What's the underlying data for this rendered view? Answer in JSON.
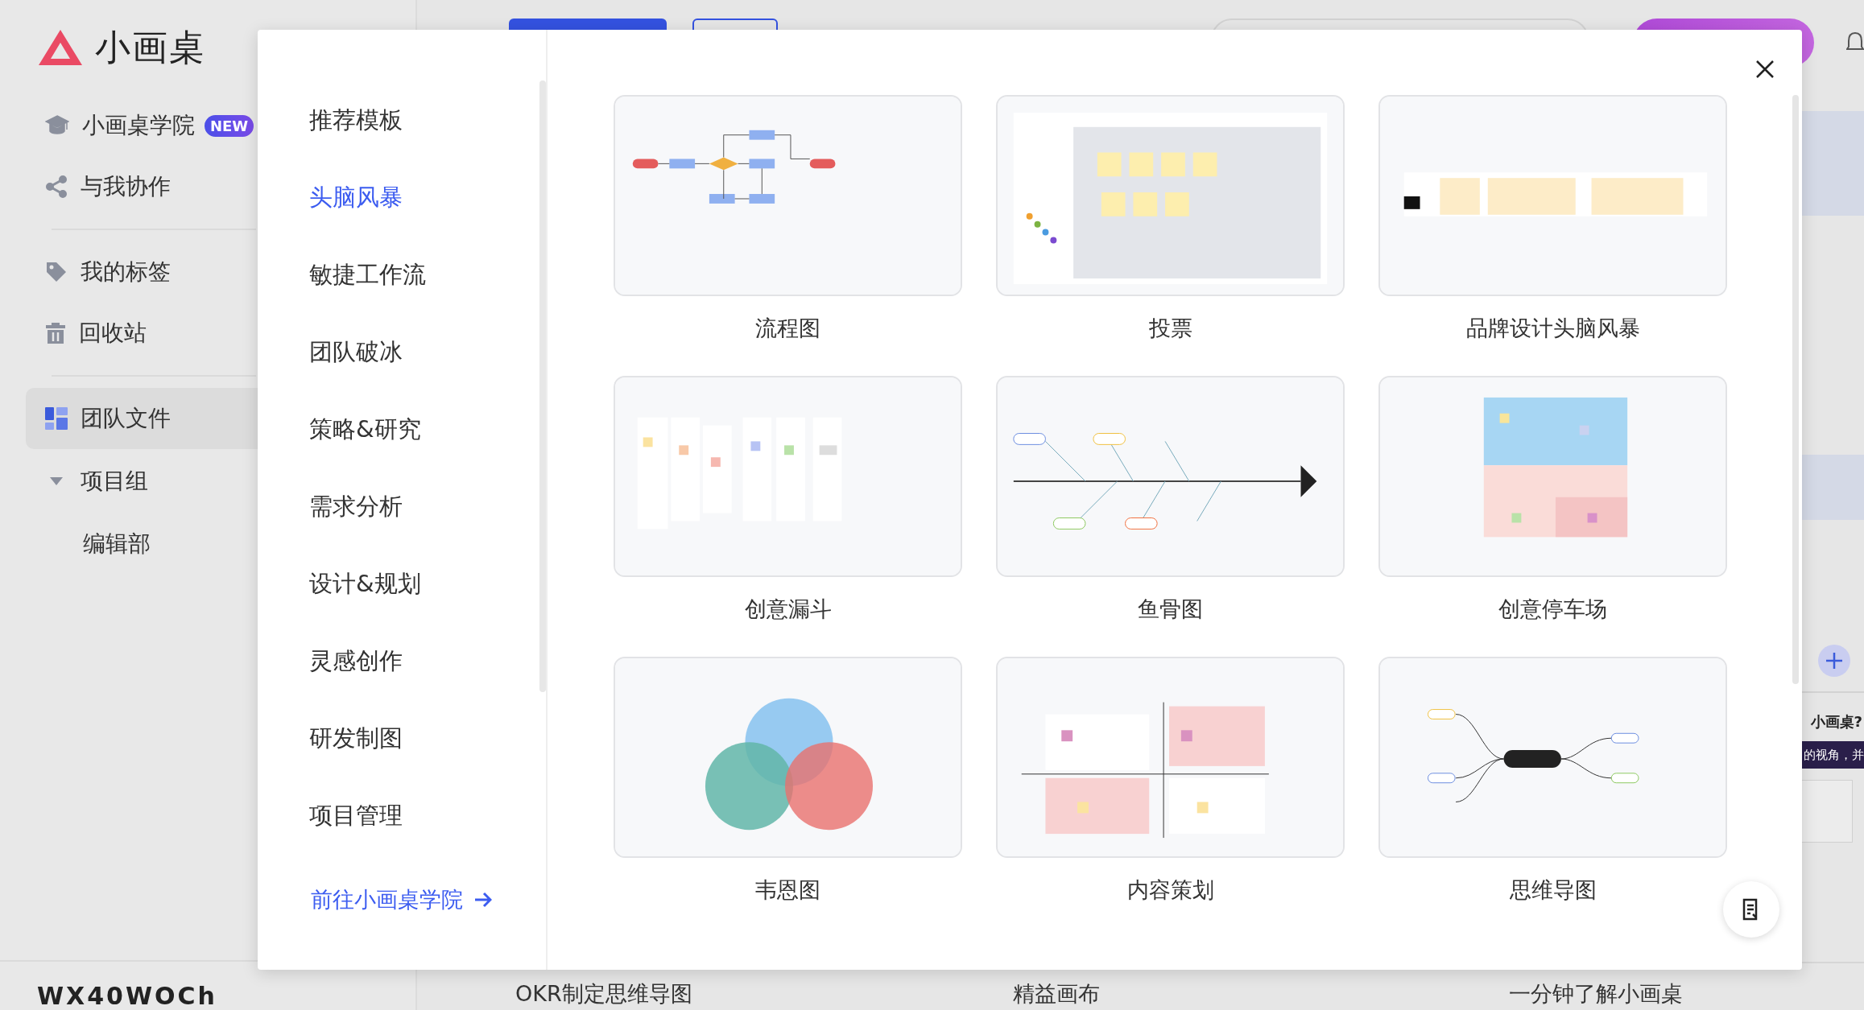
{
  "sidebar": {
    "logo": "小画桌",
    "sections": [
      [
        {
          "label": "小画桌学院",
          "kind": "academy",
          "badge": "NEW",
          "selected": false
        },
        {
          "label": "与我协作",
          "kind": "shared",
          "selected": false
        }
      ],
      [
        {
          "label": "我的标签",
          "kind": "tags",
          "selected": false
        },
        {
          "label": "回收站",
          "kind": "trash",
          "selected": false
        }
      ],
      [
        {
          "label": "团队文件",
          "kind": "team",
          "selected": true
        }
      ]
    ],
    "groups": [
      {
        "label": "项目组",
        "expanded": true,
        "children": [
          {
            "label": "编辑部"
          }
        ]
      }
    ],
    "user": "WX40WOCh"
  },
  "side_panel": {
    "heading": "小画桌?",
    "banner": "的视角，并"
  },
  "bottom_cards": [
    "OKR制定思维导图",
    "精益画布",
    "一分钟了解小画桌"
  ],
  "modal": {
    "categories": [
      {
        "label": "推荐模板",
        "selected": false
      },
      {
        "label": "头脑风暴",
        "selected": true
      },
      {
        "label": "敏捷工作流",
        "selected": false
      },
      {
        "label": "团队破冰",
        "selected": false
      },
      {
        "label": "策略&研究",
        "selected": false
      },
      {
        "label": "需求分析",
        "selected": false
      },
      {
        "label": "设计&规划",
        "selected": false
      },
      {
        "label": "灵感创作",
        "selected": false
      },
      {
        "label": "研发制图",
        "selected": false
      },
      {
        "label": "项目管理",
        "selected": false
      }
    ],
    "academy_link": "前往小画桌学院",
    "templates": [
      {
        "title": "流程图",
        "kind": "flowchart"
      },
      {
        "title": "投票",
        "kind": "vote"
      },
      {
        "title": "品牌设计头脑风暴",
        "kind": "brand"
      },
      {
        "title": "创意漏斗",
        "kind": "funnel"
      },
      {
        "title": "鱼骨图",
        "kind": "fishbone"
      },
      {
        "title": "创意停车场",
        "kind": "parking"
      },
      {
        "title": "韦恩图",
        "kind": "venn"
      },
      {
        "title": "内容策划",
        "kind": "content"
      },
      {
        "title": "思维导图",
        "kind": "mindmap"
      }
    ]
  }
}
